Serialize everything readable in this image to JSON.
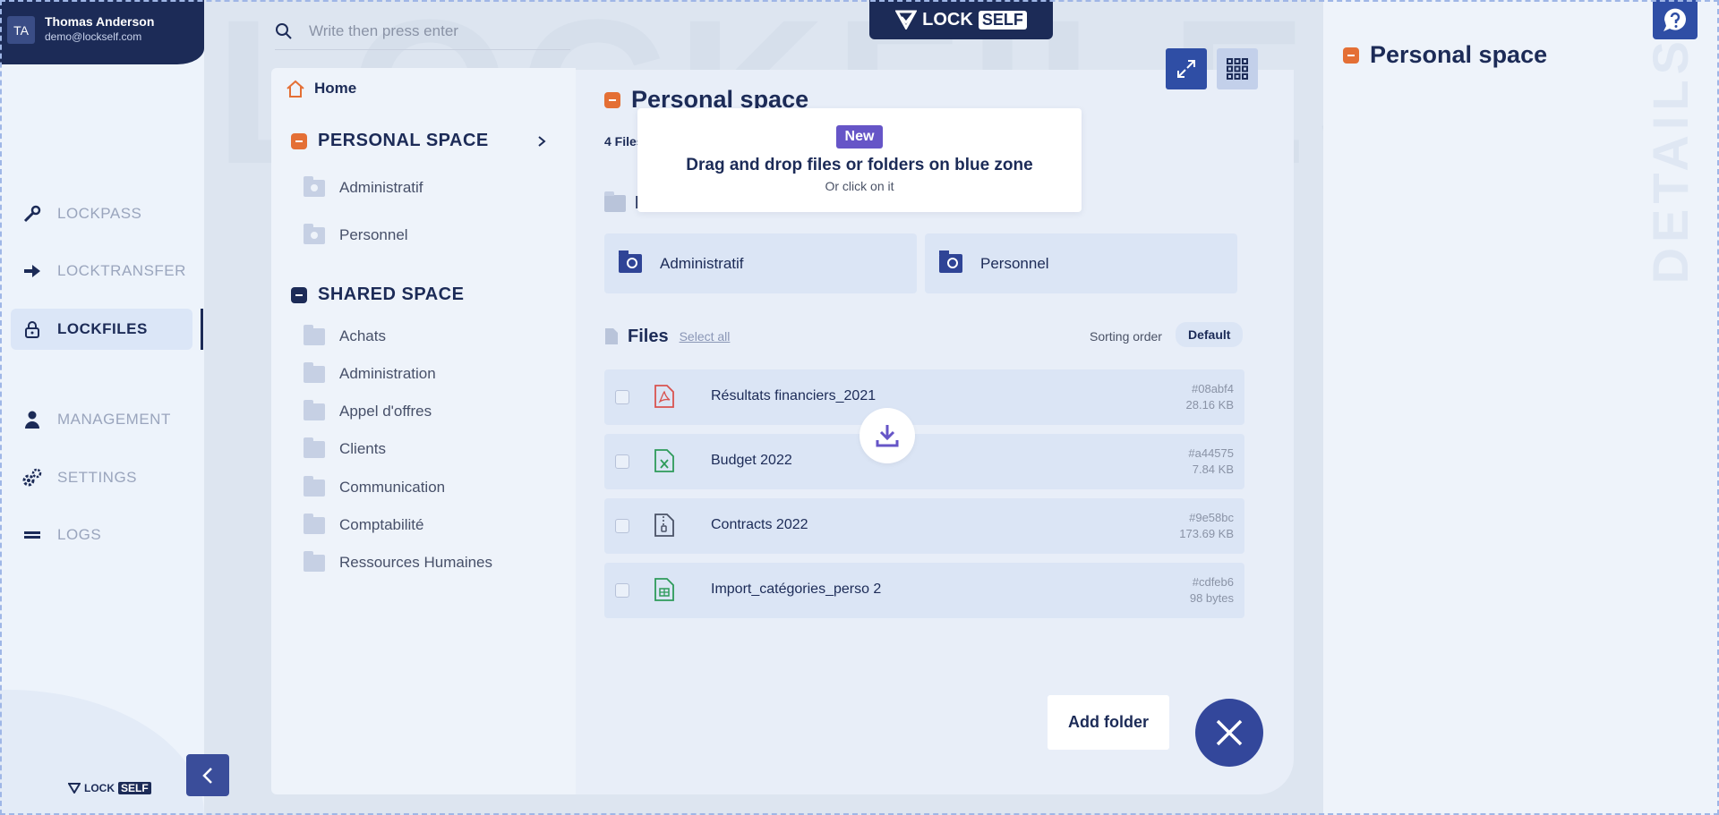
{
  "user": {
    "initials": "TA",
    "name": "Thomas Anderson",
    "email": "demo@lockself.com"
  },
  "nav": {
    "items": [
      {
        "label": "LOCKPASS",
        "icon": "key-icon"
      },
      {
        "label": "LOCKTRANSFER",
        "icon": "arrow-right-icon"
      },
      {
        "label": "LOCKFILES",
        "icon": "lock-icon",
        "active": true
      },
      {
        "label": "MANAGEMENT",
        "icon": "person-icon"
      },
      {
        "label": "SETTINGS",
        "icon": "gears-icon"
      },
      {
        "label": "LOGS",
        "icon": "logs-icon"
      }
    ]
  },
  "brand": {
    "lock": "LOCK",
    "self": "SELF",
    "watermark": "LOCKFILES",
    "details_watermark": "DETAILS"
  },
  "search": {
    "placeholder": "Write then press enter"
  },
  "tree": {
    "home": "Home",
    "personal_title": "PERSONAL SPACE",
    "personal_items": [
      "Administratif",
      "Personnel"
    ],
    "shared_title": "SHARED SPACE",
    "shared_items": [
      "Achats",
      "Administration",
      "Appel d'offres",
      "Clients",
      "Communication",
      "Comptabilité",
      "Ressources Humaines"
    ]
  },
  "main": {
    "title": "Personal space",
    "files_count": "4 Files",
    "folders_label": "F",
    "folders": [
      "Administratif",
      "Personnel"
    ],
    "files_title": "Files",
    "select_all": "Select all",
    "sorting_label": "Sorting order",
    "sorting_value": "Default",
    "files": [
      {
        "name": "Résultats financiers_2021",
        "hash": "#08abf4",
        "size": "28.16 KB",
        "type": "pdf"
      },
      {
        "name": "Budget 2022",
        "hash": "#a44575",
        "size": "7.84 KB",
        "type": "excel"
      },
      {
        "name": "Contracts 2022",
        "hash": "#9e58bc",
        "size": "173.69 KB",
        "type": "zip"
      },
      {
        "name": "Import_catégories_perso 2",
        "hash": "#cdfeb6",
        "size": "98 bytes",
        "type": "sheet"
      }
    ],
    "add_folder": "Add folder"
  },
  "popup": {
    "badge": "New",
    "title": "Drag and drop files or folders on blue zone",
    "subtitle": "Or click on it"
  },
  "details": {
    "title": "Personal space"
  },
  "colors": {
    "navy": "#1c2b57",
    "accent_blue": "#2f4ea5",
    "orange": "#e46f35",
    "purple": "#6655c7"
  }
}
